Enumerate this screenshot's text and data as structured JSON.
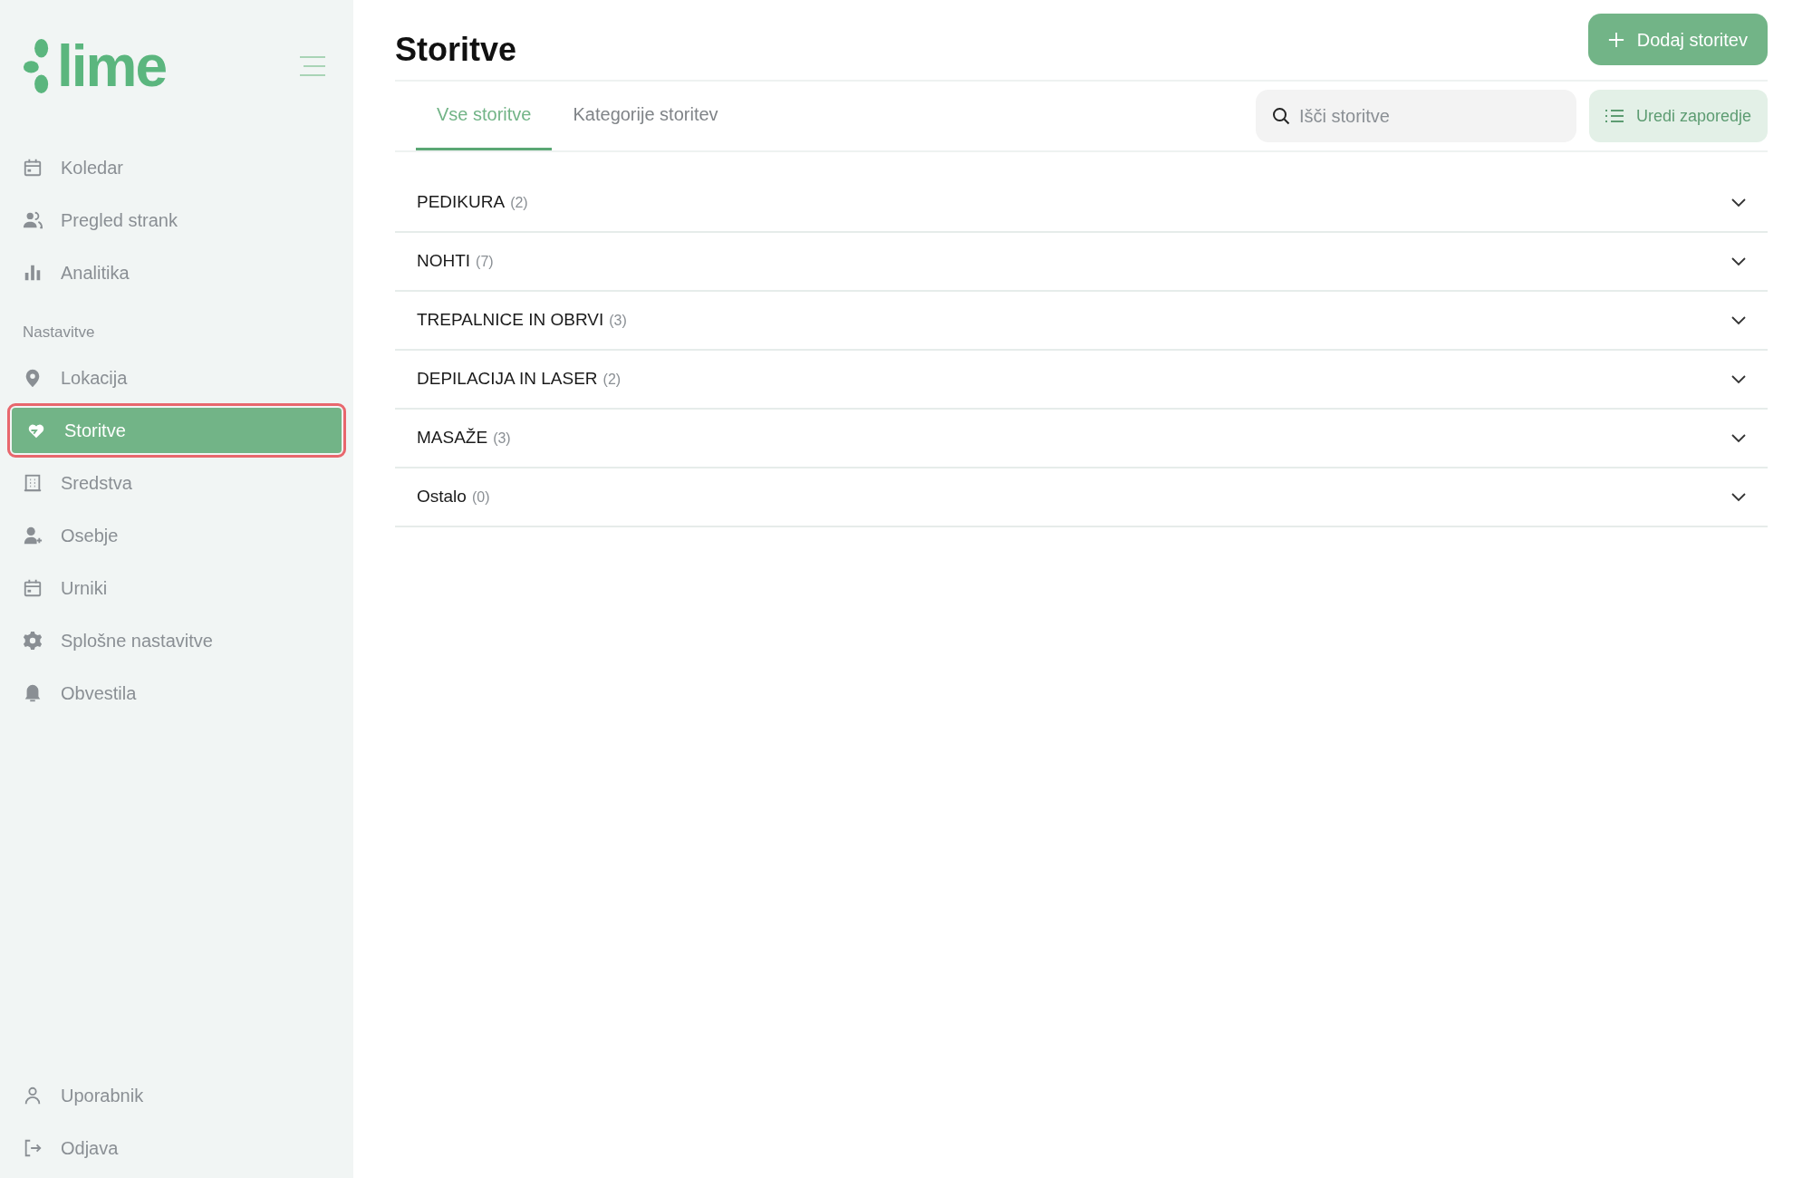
{
  "sidebar": {
    "logo": "lime",
    "main_items": [
      {
        "label": "Koledar",
        "selected": false
      },
      {
        "label": "Pregled strank",
        "selected": false
      },
      {
        "label": "Analitika",
        "selected": false
      }
    ],
    "section_title": "Nastavitve",
    "settings_items": [
      {
        "label": "Lokacija",
        "selected": false
      },
      {
        "label": "Storitve",
        "selected": true
      },
      {
        "label": "Sredstva",
        "selected": false
      },
      {
        "label": "Osebje",
        "selected": false
      },
      {
        "label": "Urniki",
        "selected": false
      },
      {
        "label": "Splošne nastavitve",
        "selected": false
      },
      {
        "label": "Obvestila",
        "selected": false
      }
    ],
    "footer_items": [
      {
        "label": "Uporabnik"
      },
      {
        "label": "Odjava"
      }
    ]
  },
  "page": {
    "title": "Storitve",
    "add_button": "Dodaj storitev",
    "tabs": [
      {
        "label": "Vse storitve",
        "selected": true
      },
      {
        "label": "Kategorije storitev",
        "selected": false
      }
    ],
    "search": {
      "placeholder": "Išči storitve"
    },
    "reorder_button": "Uredi zaporedje",
    "categories": [
      {
        "name": "PEDIKURA",
        "count": "(2)",
        "expanded": false
      },
      {
        "name": "NOHTI",
        "count": "(7)",
        "expanded": false
      },
      {
        "name": "TREPALNICE IN OBRVI",
        "count": "(3)",
        "expanded": false
      },
      {
        "name": "DEPILACIJA IN LASER",
        "count": "(2)",
        "expanded": false
      },
      {
        "name": "MASAŽE",
        "count": "(3)",
        "expanded": false
      },
      {
        "name": "Ostalo",
        "count": "(0)",
        "expanded": false
      }
    ]
  }
}
